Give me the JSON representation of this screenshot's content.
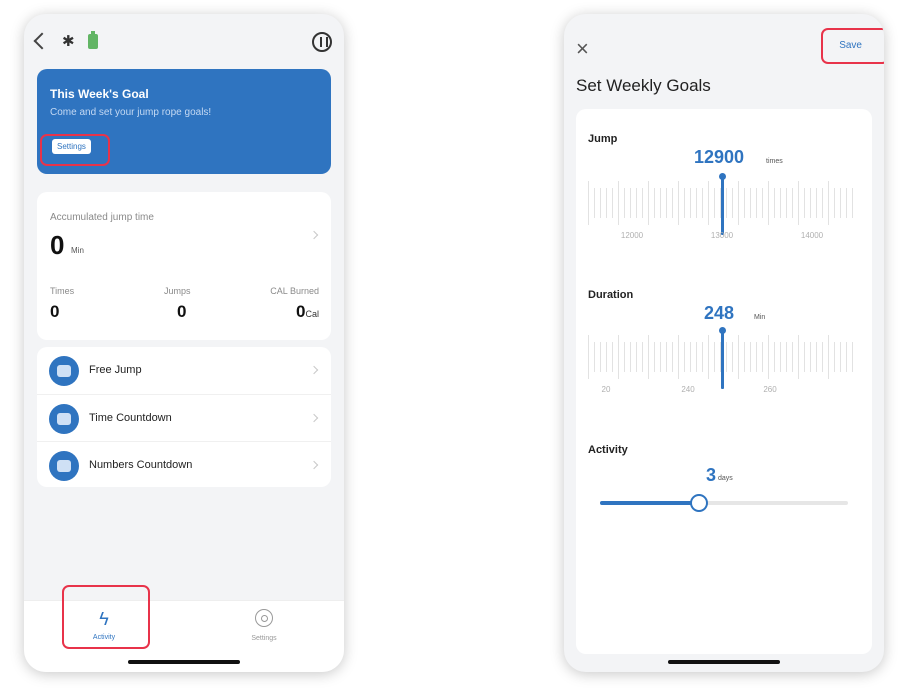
{
  "left": {
    "goal": {
      "title": "This Week's Goal",
      "subtitle": "Come and set your jump rope goals!",
      "settings_label": "Settings"
    },
    "stats": {
      "acc_label": "Accumulated jump time",
      "acc_value": "0",
      "acc_unit": "Min",
      "times_label": "Times",
      "times_value": "0",
      "jumps_label": "Jumps",
      "jumps_value": "0",
      "cal_label": "CAL Burned",
      "cal_value": "0",
      "cal_unit": "Cal"
    },
    "modes": [
      {
        "label": "Free Jump"
      },
      {
        "label": "Time Countdown"
      },
      {
        "label": "Numbers Countdown"
      }
    ],
    "tabs": [
      {
        "label": "Activity"
      },
      {
        "label": "Settings"
      }
    ],
    "accent": "#2f74c0"
  },
  "right": {
    "close_icon": "×",
    "save_label": "Save",
    "title": "Set Weekly Goals",
    "jump": {
      "label": "Jump",
      "value": "12900",
      "unit": "times",
      "ticks": [
        "12000",
        "13000",
        "14000"
      ]
    },
    "duration": {
      "label": "Duration",
      "value": "248",
      "unit": "Min",
      "ticks": [
        "20",
        "240",
        "260"
      ]
    },
    "activity": {
      "label": "Activity",
      "value": "3",
      "unit": "days",
      "level_fraction": 0.4
    }
  },
  "highlight_color": "#e8334a"
}
